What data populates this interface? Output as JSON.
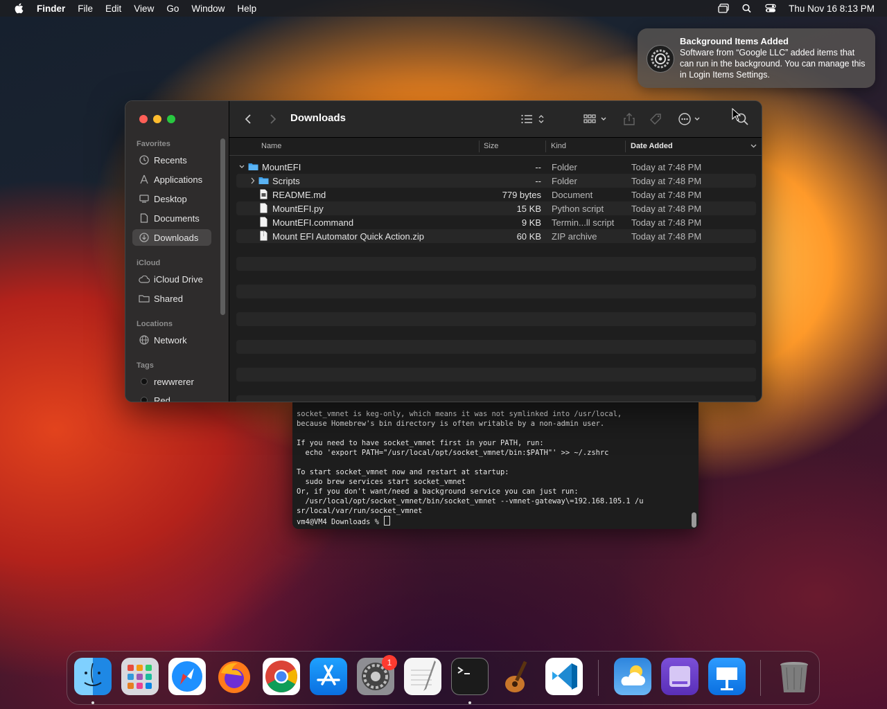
{
  "menubar": {
    "app_name": "Finder",
    "menus": [
      "File",
      "Edit",
      "View",
      "Go",
      "Window",
      "Help"
    ],
    "clock": "Thu Nov 16  8:13 PM",
    "icons": [
      "screen-mirroring-icon",
      "spotlight-search-icon",
      "control-center-icon"
    ]
  },
  "notification": {
    "title": "Background Items Added",
    "body": "Software from “Google LLC” added items that can run in the background. You can manage this in Login Items Settings.",
    "icon": "system-settings-gear-icon"
  },
  "finder": {
    "title": "Downloads",
    "sidebar": {
      "favorites_header": "Favorites",
      "favorites": [
        "Recents",
        "Applications",
        "Desktop",
        "Documents",
        "Downloads"
      ],
      "icloud_header": "iCloud",
      "icloud": [
        "iCloud Drive",
        "Shared"
      ],
      "locations_header": "Locations",
      "locations": [
        "Network"
      ],
      "tags_header": "Tags",
      "tags": [
        "rewwrerer",
        "Red"
      ],
      "selected": "Downloads"
    },
    "columns": {
      "name": "Name",
      "size": "Size",
      "kind": "Kind",
      "date": "Date Added"
    },
    "files": [
      {
        "name": "MountEFI",
        "size": "--",
        "kind": "Folder",
        "date": "Today at 7:48 PM"
      },
      {
        "name": "Scripts",
        "size": "--",
        "kind": "Folder",
        "date": "Today at 7:48 PM"
      },
      {
        "name": "README.md",
        "size": "779 bytes",
        "kind": "Document",
        "date": "Today at 7:48 PM"
      },
      {
        "name": "MountEFI.py",
        "size": "15 KB",
        "kind": "Python script",
        "date": "Today at 7:48 PM"
      },
      {
        "name": "MountEFI.command",
        "size": "9 KB",
        "kind": "Termin...ll script",
        "date": "Today at 7:48 PM"
      },
      {
        "name": "Mount EFI Automator Quick Action.zip",
        "size": "60 KB",
        "kind": "ZIP archive",
        "date": "Today at 7:48 PM"
      }
    ]
  },
  "terminal": {
    "lines": [
      "socket_vmnet is keg-only, which means it was not symlinked into /usr/local,",
      "because Homebrew's bin directory is often writable by a non-admin user.",
      "",
      "If you need to have socket_vmnet first in your PATH, run:",
      "  echo 'export PATH=\"/usr/local/opt/socket_vmnet/bin:$PATH\"' >> ~/.zshrc",
      "",
      "To start socket_vmnet now and restart at startup:",
      "  sudo brew services start socket_vmnet",
      "Or, if you don't want/need a background service you can just run:",
      "  /usr/local/opt/socket_vmnet/bin/socket_vmnet --vmnet-gateway\\=192.168.105.1 /u",
      "sr/local/var/run/socket_vmnet"
    ],
    "prompt": "vm4@VM4 Downloads % "
  },
  "dock": {
    "apps": [
      "Finder",
      "Launchpad",
      "Safari",
      "Firefox",
      "Google Chrome",
      "App Store",
      "System Settings",
      "TextEdit",
      "Terminal",
      "GarageBand",
      "Visual Studio Code",
      "Weather",
      "Disk Utility",
      "Keynote",
      "Trash"
    ],
    "settings_badge": "1"
  }
}
